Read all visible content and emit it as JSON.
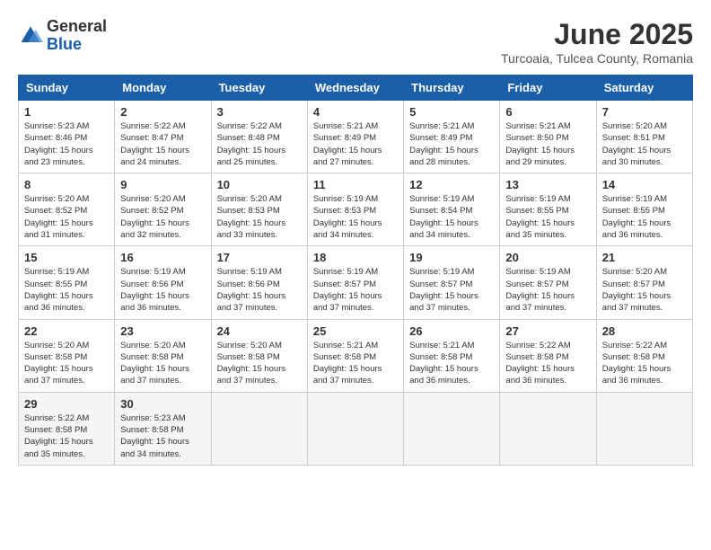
{
  "header": {
    "logo": {
      "general": "General",
      "blue": "Blue"
    },
    "title": "June 2025",
    "location": "Turcoaia, Tulcea County, Romania"
  },
  "calendar": {
    "columns": [
      "Sunday",
      "Monday",
      "Tuesday",
      "Wednesday",
      "Thursday",
      "Friday",
      "Saturday"
    ],
    "weeks": [
      [
        {
          "day": "1",
          "info": "Sunrise: 5:23 AM\nSunset: 8:46 PM\nDaylight: 15 hours\nand 23 minutes."
        },
        {
          "day": "2",
          "info": "Sunrise: 5:22 AM\nSunset: 8:47 PM\nDaylight: 15 hours\nand 24 minutes."
        },
        {
          "day": "3",
          "info": "Sunrise: 5:22 AM\nSunset: 8:48 PM\nDaylight: 15 hours\nand 25 minutes."
        },
        {
          "day": "4",
          "info": "Sunrise: 5:21 AM\nSunset: 8:49 PM\nDaylight: 15 hours\nand 27 minutes."
        },
        {
          "day": "5",
          "info": "Sunrise: 5:21 AM\nSunset: 8:49 PM\nDaylight: 15 hours\nand 28 minutes."
        },
        {
          "day": "6",
          "info": "Sunrise: 5:21 AM\nSunset: 8:50 PM\nDaylight: 15 hours\nand 29 minutes."
        },
        {
          "day": "7",
          "info": "Sunrise: 5:20 AM\nSunset: 8:51 PM\nDaylight: 15 hours\nand 30 minutes."
        }
      ],
      [
        {
          "day": "8",
          "info": "Sunrise: 5:20 AM\nSunset: 8:52 PM\nDaylight: 15 hours\nand 31 minutes."
        },
        {
          "day": "9",
          "info": "Sunrise: 5:20 AM\nSunset: 8:52 PM\nDaylight: 15 hours\nand 32 minutes."
        },
        {
          "day": "10",
          "info": "Sunrise: 5:20 AM\nSunset: 8:53 PM\nDaylight: 15 hours\nand 33 minutes."
        },
        {
          "day": "11",
          "info": "Sunrise: 5:19 AM\nSunset: 8:53 PM\nDaylight: 15 hours\nand 34 minutes."
        },
        {
          "day": "12",
          "info": "Sunrise: 5:19 AM\nSunset: 8:54 PM\nDaylight: 15 hours\nand 34 minutes."
        },
        {
          "day": "13",
          "info": "Sunrise: 5:19 AM\nSunset: 8:55 PM\nDaylight: 15 hours\nand 35 minutes."
        },
        {
          "day": "14",
          "info": "Sunrise: 5:19 AM\nSunset: 8:55 PM\nDaylight: 15 hours\nand 36 minutes."
        }
      ],
      [
        {
          "day": "15",
          "info": "Sunrise: 5:19 AM\nSunset: 8:55 PM\nDaylight: 15 hours\nand 36 minutes."
        },
        {
          "day": "16",
          "info": "Sunrise: 5:19 AM\nSunset: 8:56 PM\nDaylight: 15 hours\nand 36 minutes."
        },
        {
          "day": "17",
          "info": "Sunrise: 5:19 AM\nSunset: 8:56 PM\nDaylight: 15 hours\nand 37 minutes."
        },
        {
          "day": "18",
          "info": "Sunrise: 5:19 AM\nSunset: 8:57 PM\nDaylight: 15 hours\nand 37 minutes."
        },
        {
          "day": "19",
          "info": "Sunrise: 5:19 AM\nSunset: 8:57 PM\nDaylight: 15 hours\nand 37 minutes."
        },
        {
          "day": "20",
          "info": "Sunrise: 5:19 AM\nSunset: 8:57 PM\nDaylight: 15 hours\nand 37 minutes."
        },
        {
          "day": "21",
          "info": "Sunrise: 5:20 AM\nSunset: 8:57 PM\nDaylight: 15 hours\nand 37 minutes."
        }
      ],
      [
        {
          "day": "22",
          "info": "Sunrise: 5:20 AM\nSunset: 8:58 PM\nDaylight: 15 hours\nand 37 minutes."
        },
        {
          "day": "23",
          "info": "Sunrise: 5:20 AM\nSunset: 8:58 PM\nDaylight: 15 hours\nand 37 minutes."
        },
        {
          "day": "24",
          "info": "Sunrise: 5:20 AM\nSunset: 8:58 PM\nDaylight: 15 hours\nand 37 minutes."
        },
        {
          "day": "25",
          "info": "Sunrise: 5:21 AM\nSunset: 8:58 PM\nDaylight: 15 hours\nand 37 minutes."
        },
        {
          "day": "26",
          "info": "Sunrise: 5:21 AM\nSunset: 8:58 PM\nDaylight: 15 hours\nand 36 minutes."
        },
        {
          "day": "27",
          "info": "Sunrise: 5:22 AM\nSunset: 8:58 PM\nDaylight: 15 hours\nand 36 minutes."
        },
        {
          "day": "28",
          "info": "Sunrise: 5:22 AM\nSunset: 8:58 PM\nDaylight: 15 hours\nand 36 minutes."
        }
      ],
      [
        {
          "day": "29",
          "info": "Sunrise: 5:22 AM\nSunset: 8:58 PM\nDaylight: 15 hours\nand 35 minutes."
        },
        {
          "day": "30",
          "info": "Sunrise: 5:23 AM\nSunset: 8:58 PM\nDaylight: 15 hours\nand 34 minutes."
        },
        {
          "day": "",
          "info": ""
        },
        {
          "day": "",
          "info": ""
        },
        {
          "day": "",
          "info": ""
        },
        {
          "day": "",
          "info": ""
        },
        {
          "day": "",
          "info": ""
        }
      ]
    ]
  }
}
